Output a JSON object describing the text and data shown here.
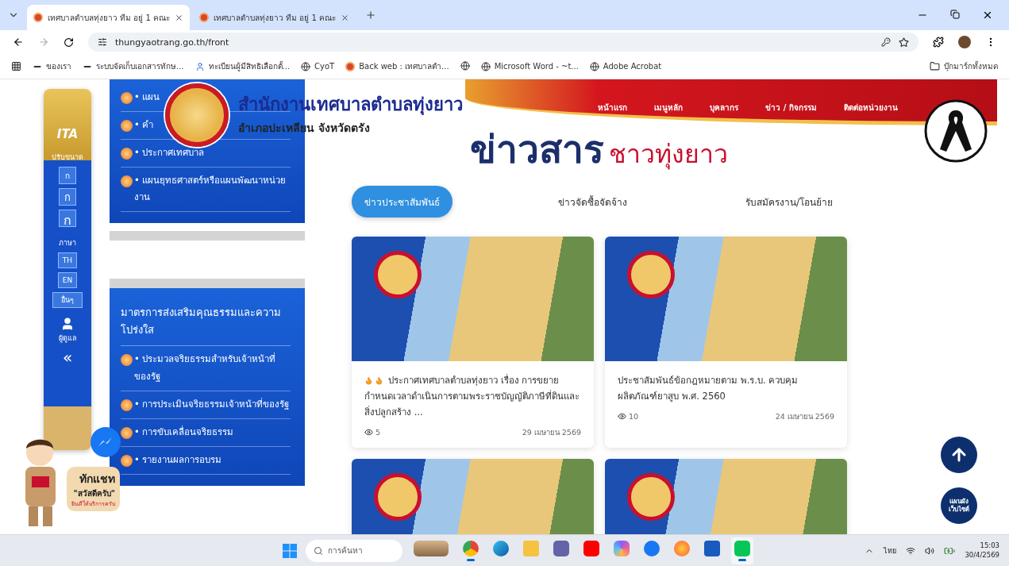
{
  "browser": {
    "tabs": [
      {
        "title": "เทศบาลตำบลทุ่งยาว ทีม อยู่ 1 คณะ",
        "selected": true
      },
      {
        "title": "เทศบาลตำบลทุ่งยาว ทีม อยู่ 1 คณะ",
        "selected": false
      }
    ],
    "url": "thungyaotrang.go.th/front",
    "bookmarks": [
      {
        "kind": "folder-dark",
        "title": "ของเรา"
      },
      {
        "kind": "folder-dark",
        "title": "ระบบจัดเก็บเอกสารทักษ..."
      },
      {
        "kind": "person",
        "title": "ทะเบียนผู้มีสิทธิเลือกตั้..."
      },
      {
        "kind": "globe",
        "title": "CyoT"
      },
      {
        "kind": "site",
        "title": "Back web : เทศบาลตำ..."
      },
      {
        "kind": "globe"
      },
      {
        "kind": "globe",
        "title": "Microsoft Word - ~t..."
      },
      {
        "kind": "globe",
        "title": "Adobe Acrobat"
      }
    ],
    "all_bookmarks": "บุ๊กมาร์กทั้งหมด"
  },
  "site": {
    "title": "สำนักงานเทศบาลตำบลทุ่งยาว",
    "subtitle": "อำเภอปะเหลียน จังหวัดตรัง",
    "nav": [
      "หน้าแรก",
      "เมนูหลัก",
      "บุคลากร",
      "ข่าว / กิจกรรม",
      "ติดต่อหน่วยงาน"
    ]
  },
  "accessibility": {
    "badge": "ITA",
    "size_label": "ปรับขนาด",
    "size_buttons": [
      "ก",
      "ก",
      "ก"
    ],
    "language_label": "ภาษา",
    "languages": [
      "TH",
      "EN",
      "อื่นๆ"
    ],
    "admin_label": "ผู้ดูแล",
    "collapse": "«"
  },
  "side_menus": [
    {
      "items": [
        "• แผน",
        "• คำ",
        "• ประกาศเทศบาล",
        "• แผนยุทธศาสตร์หรือแผนพัฒนาหน่วยงาน"
      ]
    },
    {
      "heading": "มาตรการส่งเสริมคุณธรรมและความโปร่งใส",
      "items": [
        "• ประมวลจริยธรรมสำหรับเจ้าหน้าที่ของรัฐ",
        "• การประเมินจริยธรรมเจ้าหน้าที่ของรัฐ",
        "• การขับเคลื่อนจริยธรรม",
        "• รายงานผลการอบรม"
      ]
    }
  ],
  "news": {
    "heading": "ข่าวสาร",
    "heading_accent": "ชาวทุ่งยาว",
    "tabs": [
      {
        "label": "ข่าวประชาสัมพันธ์",
        "selected": true
      },
      {
        "label": "ข่าวจัดซื้อจัดจ้าง",
        "selected": false
      },
      {
        "label": "รับสมัครงาน/โอนย้าย",
        "selected": false
      }
    ],
    "cards": [
      {
        "kind": "article",
        "hot": true,
        "text": "ประกาศเทศบาลตำบลทุ่งยาว เรื่อง การขยายกำหนดเวลาดำเนินการตามพระราชบัญญัติภาษีที่ดินและสิ่งปลูกสร้าง ...",
        "views": "5",
        "date": "29 เมษายน 2569"
      },
      {
        "kind": "article",
        "hot": false,
        "text": "ประชาสัมพันธ์ข้อกฎหมายตาม พ.ร.บ. ควบคุมผลิตภัณฑ์ยาสูบ พ.ศ. 2560",
        "views": "10",
        "date": "24 เมษายน 2569"
      },
      {
        "kind": "photo"
      },
      {
        "kind": "photo"
      }
    ]
  },
  "sitemap_button": "แผนผัง เว็บไซต์",
  "chat": {
    "title": "ทักแชท",
    "greeting": "\"สวัสดีครับ\"",
    "note": "ยินดีให้บริการครับ"
  },
  "taskbar": {
    "search_placeholder": "การค้นหา",
    "apps": [
      {
        "kind": "widget",
        "active": false
      },
      {
        "kind": "chrome",
        "active": true
      },
      {
        "kind": "edge",
        "active": false
      },
      {
        "kind": "files",
        "active": false
      },
      {
        "kind": "teams",
        "active": false
      },
      {
        "kind": "youtube",
        "active": false
      },
      {
        "kind": "copilot",
        "active": false
      },
      {
        "kind": "facebook",
        "active": false
      },
      {
        "kind": "firefox",
        "active": false
      },
      {
        "kind": "word",
        "active": false
      },
      {
        "kind": "line",
        "active": true
      }
    ],
    "language": "ไทย",
    "time": "15:03",
    "date": "30/4/2569"
  }
}
